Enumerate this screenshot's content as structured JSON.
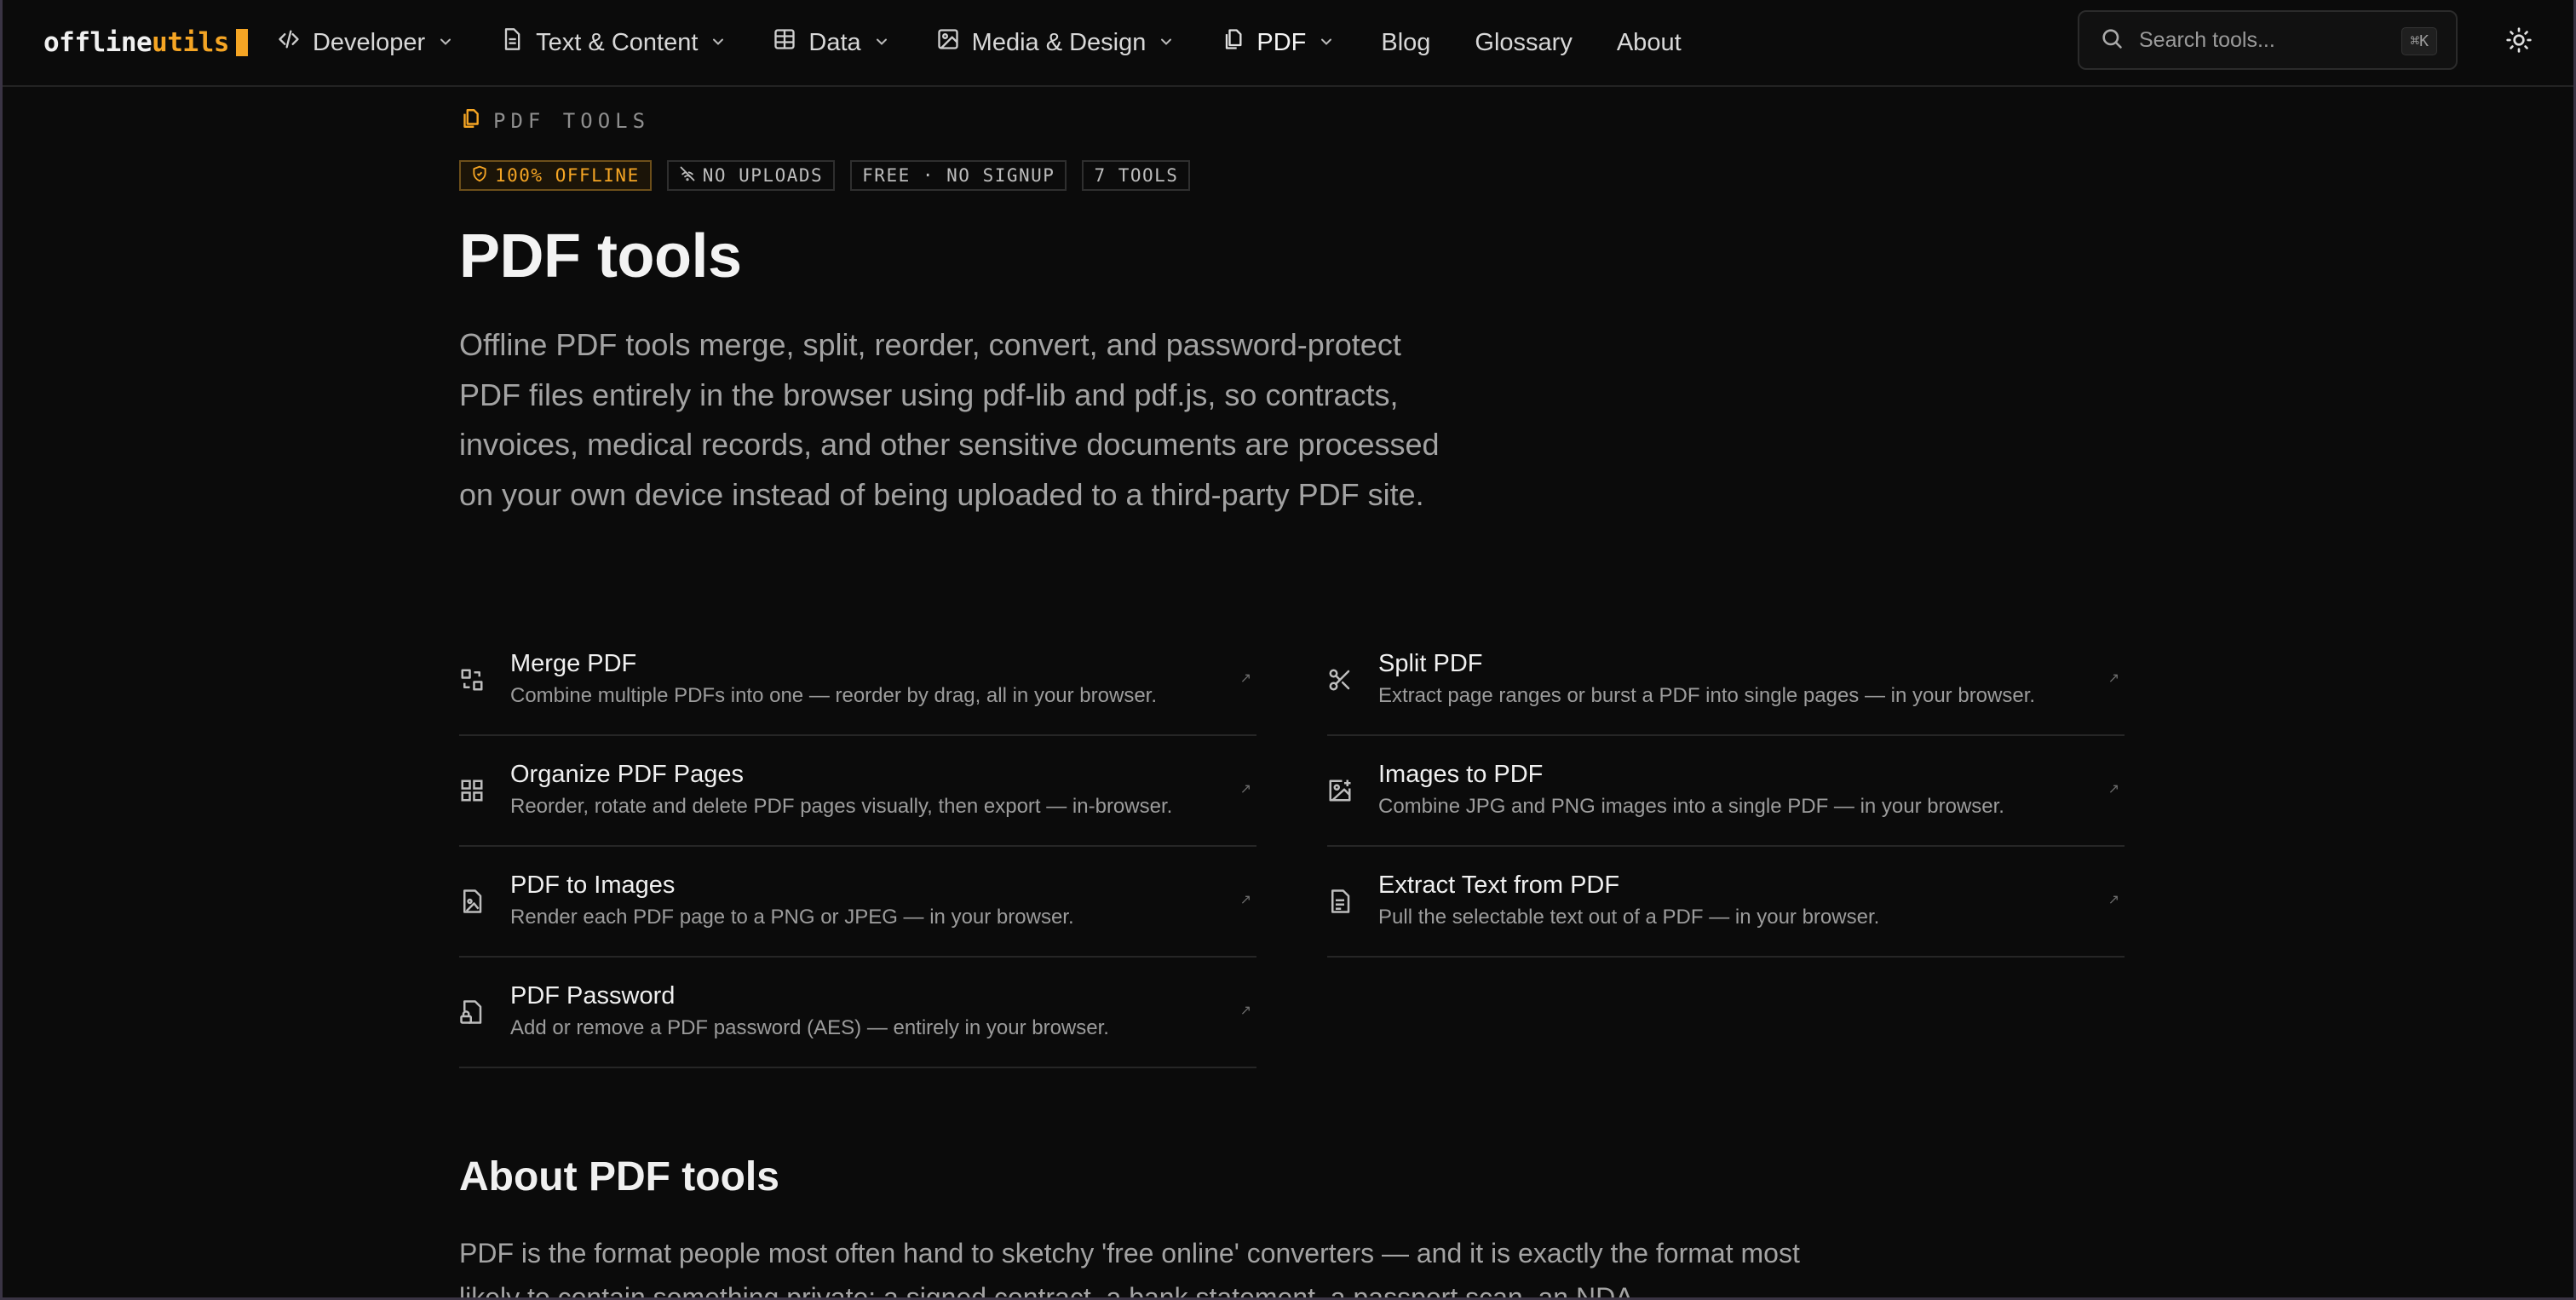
{
  "header": {
    "logo_part1": "offline",
    "logo_part2": "utils",
    "nav": [
      {
        "label": "Developer",
        "icon": "code-icon"
      },
      {
        "label": "Text & Content",
        "icon": "document-icon"
      },
      {
        "label": "Data",
        "icon": "table-icon"
      },
      {
        "label": "Media & Design",
        "icon": "image-icon"
      },
      {
        "label": "PDF",
        "icon": "pdf-files-icon",
        "active": true
      }
    ],
    "links": [
      "Blog",
      "Glossary",
      "About"
    ],
    "search": {
      "placeholder": "Search tools...",
      "shortcut": "⌘K"
    },
    "theme_toggle_icon": "sun-icon"
  },
  "page": {
    "eyebrow": "PDF TOOLS",
    "badges": [
      {
        "label": "100% OFFLINE",
        "icon": "shield-icon",
        "accent": true
      },
      {
        "label": "NO UPLOADS",
        "icon": "no-wifi-icon"
      },
      {
        "label": "FREE · NO SIGNUP"
      },
      {
        "label": "7 TOOLS"
      }
    ],
    "title": "PDF tools",
    "lead": "Offline PDF tools merge, split, reorder, convert, and password-protect PDF files entirely in the browser using pdf-lib and pdf.js, so contracts, invoices, medical records, and other sensitive documents are processed on your own device instead of being uploaded to a third-party PDF site.",
    "tools": [
      {
        "name": "Merge PDF",
        "desc": "Combine multiple PDFs into one — reorder by drag, all in your browser.",
        "icon": "merge-icon"
      },
      {
        "name": "Split PDF",
        "desc": "Extract page ranges or burst a PDF into single pages — in your browser.",
        "icon": "scissors-icon"
      },
      {
        "name": "Organize PDF Pages",
        "desc": "Reorder, rotate and delete PDF pages visually, then export — in-browser.",
        "icon": "grid-icon"
      },
      {
        "name": "Images to PDF",
        "desc": "Combine JPG and PNG images into a single PDF — in your browser.",
        "icon": "image-plus-icon"
      },
      {
        "name": "PDF to Images",
        "desc": "Render each PDF page to a PNG or JPEG — in your browser.",
        "icon": "file-image-icon"
      },
      {
        "name": "Extract Text from PDF",
        "desc": "Pull the selectable text out of a PDF — in your browser.",
        "icon": "file-text-icon"
      },
      {
        "name": "PDF Password",
        "desc": "Add or remove a PDF password (AES) — entirely in your browser.",
        "icon": "file-lock-icon"
      }
    ],
    "tool_arrow": "↗",
    "about_title": "About PDF tools",
    "about_text": "PDF is the format people most often hand to sketchy 'free online' converters — and it is exactly the format most likely to contain something private: a signed contract, a bank statement, a passport scan, an NDA."
  },
  "colors": {
    "accent": "#f5a524",
    "background": "#0b0b0b",
    "text": "#e9e9e9",
    "muted": "#a3a3a3"
  }
}
